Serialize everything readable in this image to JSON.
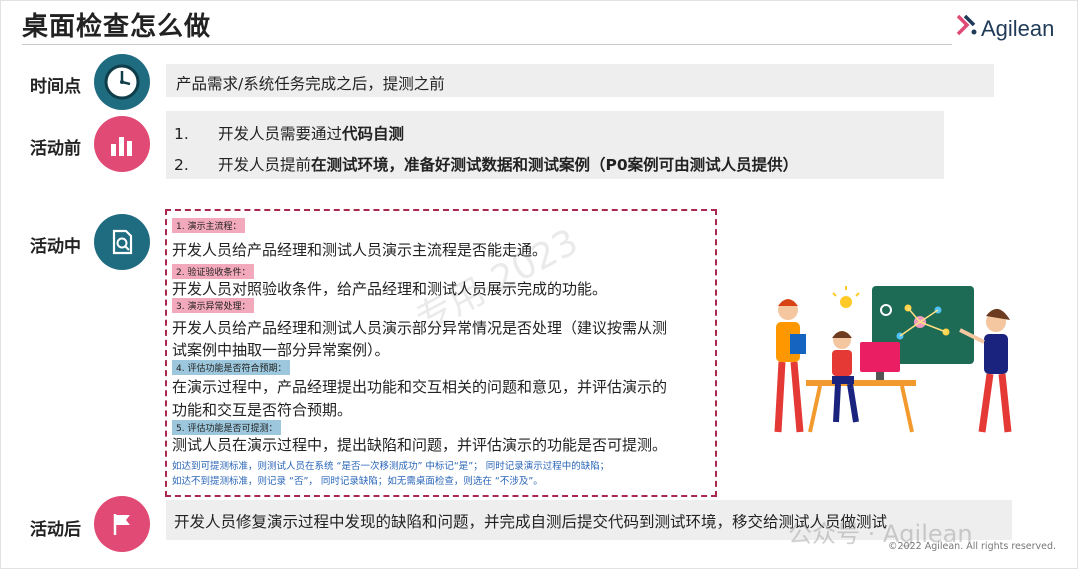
{
  "title": "桌面检查怎么做",
  "logo": {
    "text": "Agilean"
  },
  "rows": {
    "timepoint": {
      "label": "时间点",
      "icon": "clock-icon",
      "text": "产品需求/系统任务完成之后，提测之前"
    },
    "before": {
      "label": "活动前",
      "icon": "bar-chart-icon",
      "items": [
        {
          "num": "1.",
          "plain": "开发人员需要通过",
          "bold": "代码自测"
        },
        {
          "num": "2.",
          "plain": "开发人员提前",
          "bold": "在测试环境，准备好测试数据和测试案例（P0案例可由测试人员提供）"
        }
      ]
    },
    "during": {
      "label": "活动中",
      "icon": "document-search-icon",
      "sections": [
        {
          "tag": "1. 演示主流程：",
          "lines": [
            "开发人员给产品经理和测试人员演示主流程是否能走通。"
          ]
        },
        {
          "tag": "2. 验证验收条件：",
          "lines": [
            "开发人员对照验收条件，给产品经理和测试人员展示完成的功能。"
          ]
        },
        {
          "tag": "3. 演示异常处理：",
          "lines": [
            "开发人员给产品经理和测试人员演示部分异常情况是否处理（建议按需从测",
            "试案例中抽取一部分异常案例）。"
          ]
        },
        {
          "tag": "4. 评估功能是否符合预期：",
          "lines": [
            "在演示过程中，产品经理提出功能和交互相关的问题和意见，并评估演示的",
            "功能和交互是否符合预期。"
          ]
        },
        {
          "tag": "5. 评估功能是否可提测：",
          "lines": [
            "测试人员在演示过程中，提出缺陷和问题，并评估演示的功能是否可提测。"
          ]
        }
      ],
      "notes": [
        "如达到可提测标准，则测试人员在系统 “是否一次移测成功” 中标记“是”；  同时记录演示过程中的缺陷；",
        "如达不到提测标准，则记录 “否”，  同时记录缺陷；如无需桌面检查，则选在 “不涉及”。"
      ]
    },
    "after": {
      "label": "活动后",
      "icon": "flag-icon",
      "text": "开发人员修复演示过程中发现的缺陷和问题，并完成自测后提交代码到测试环境，移交给测试人员做测试"
    }
  },
  "watermark": "-专用-2023",
  "wechat_watermark": "公众号 · Agilean",
  "copyright": "©2022 Agilean. All rights reserved.",
  "colors": {
    "teal": "#1f6b7f",
    "pink": "#e04a74",
    "dash": "#a8284e",
    "tag_pink": "#f1a9bb",
    "tag_blue": "#9cc7dc",
    "note_blue": "#2a66b7"
  }
}
